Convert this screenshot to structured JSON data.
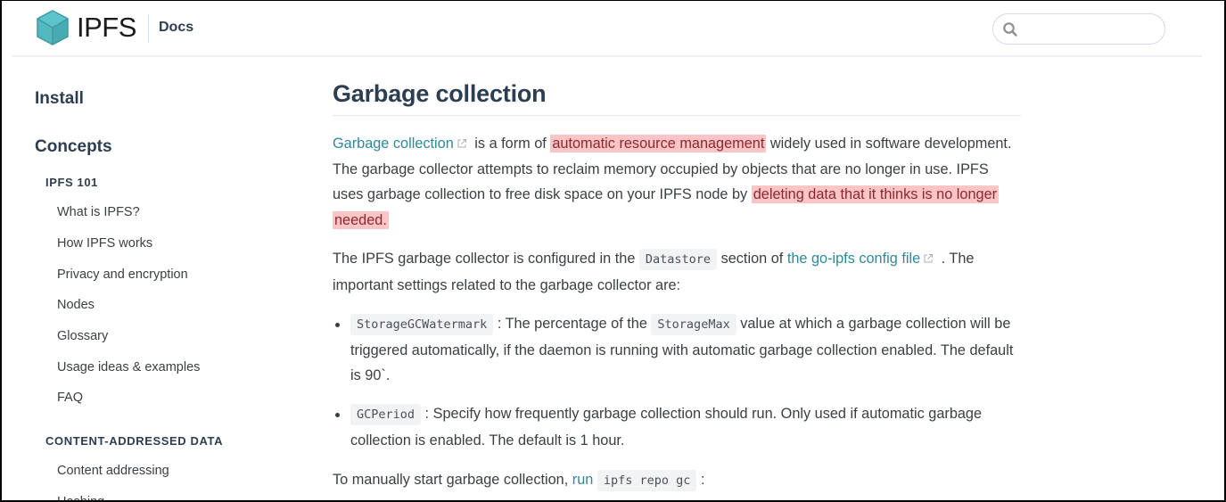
{
  "header": {
    "brand": "IPFS",
    "section": "Docs",
    "search": {
      "placeholder": "",
      "value": ""
    }
  },
  "sidebar": {
    "sections": [
      {
        "label": "Install"
      },
      {
        "label": "Concepts"
      }
    ],
    "groups": [
      {
        "label": "IPFS 101",
        "items": [
          "What is IPFS?",
          "How IPFS works",
          "Privacy and encryption",
          "Nodes",
          "Glossary",
          "Usage ideas & examples",
          "FAQ"
        ]
      },
      {
        "label": "CONTENT-ADDRESSED DATA",
        "items": [
          "Content addressing",
          "Hashing"
        ]
      }
    ]
  },
  "main": {
    "title": "Garbage collection",
    "p1": {
      "link": "Garbage collection",
      "t1": " is a form of ",
      "hl1": "automatic resource management",
      "t2": " widely used in software development. The garbage collector attempts to reclaim memory occupied by objects that are no longer in use. IPFS uses garbage collection to free disk space on your IPFS node by ",
      "hl2": "deleting data that it thinks is no longer needed."
    },
    "p2": {
      "t1": "The IPFS garbage collector is configured in the ",
      "code": "Datastore",
      "t2": " section of ",
      "link": "the go-ipfs config file",
      "t3": " . The important settings related to the garbage collector are:"
    },
    "list": [
      {
        "code": "StorageGCWatermark",
        "t1": " : The percentage of the ",
        "code2": "StorageMax",
        "t2": " value at which a garbage collection will be triggered automatically, if the daemon is running with automatic garbage collection enabled. The default is 90`."
      },
      {
        "code": "GCPeriod",
        "t1": " : Specify how frequently garbage collection should run. Only used if automatic garbage collection is enabled. The default is 1 hour."
      }
    ],
    "p3": {
      "t1": "To manually start garbage collection, ",
      "link": "run",
      "code": "ipfs repo gc",
      "t2": " :"
    }
  },
  "colors": {
    "link": "#2e8a96",
    "highlight_bg": "#fbc5c5",
    "highlight_text": "#8b2733",
    "brand_cube": "#5bc0c8"
  }
}
